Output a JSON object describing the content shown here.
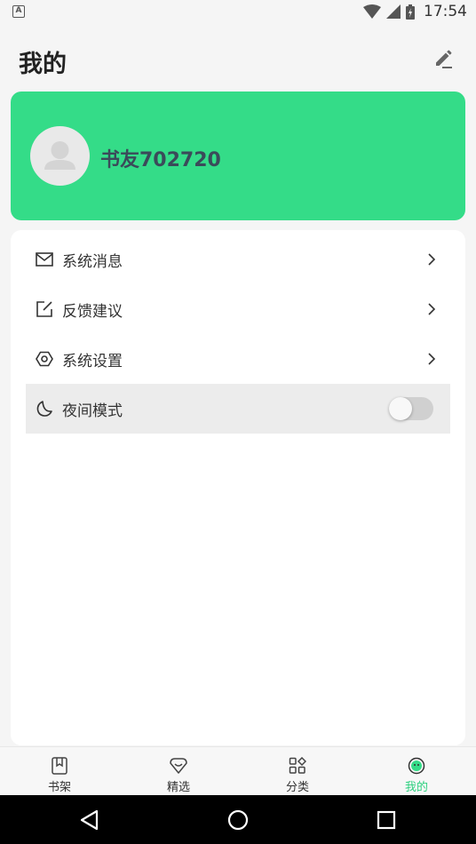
{
  "status_bar": {
    "time": "17:54",
    "left_icon": "A"
  },
  "header": {
    "title": "我的",
    "edit_icon": "pencil-icon"
  },
  "profile": {
    "username": "书友702720",
    "avatar_icon": "default-avatar-icon"
  },
  "menu": {
    "items": [
      {
        "label": "系统消息",
        "icon": "mail-icon"
      },
      {
        "label": "反馈建议",
        "icon": "feedback-icon"
      },
      {
        "label": "系统设置",
        "icon": "settings-icon"
      },
      {
        "label": "夜间模式",
        "icon": "moon-icon",
        "toggle_on": false
      }
    ]
  },
  "bottom_nav": {
    "items": [
      {
        "label": "书架",
        "icon": "bookshelf-icon",
        "active": false
      },
      {
        "label": "精选",
        "icon": "featured-icon",
        "active": false
      },
      {
        "label": "分类",
        "icon": "category-icon",
        "active": false
      },
      {
        "label": "我的",
        "icon": "profile-icon",
        "active": true
      }
    ]
  },
  "colors": {
    "accent": "#34dc88",
    "active_tab": "#2dd07f"
  }
}
